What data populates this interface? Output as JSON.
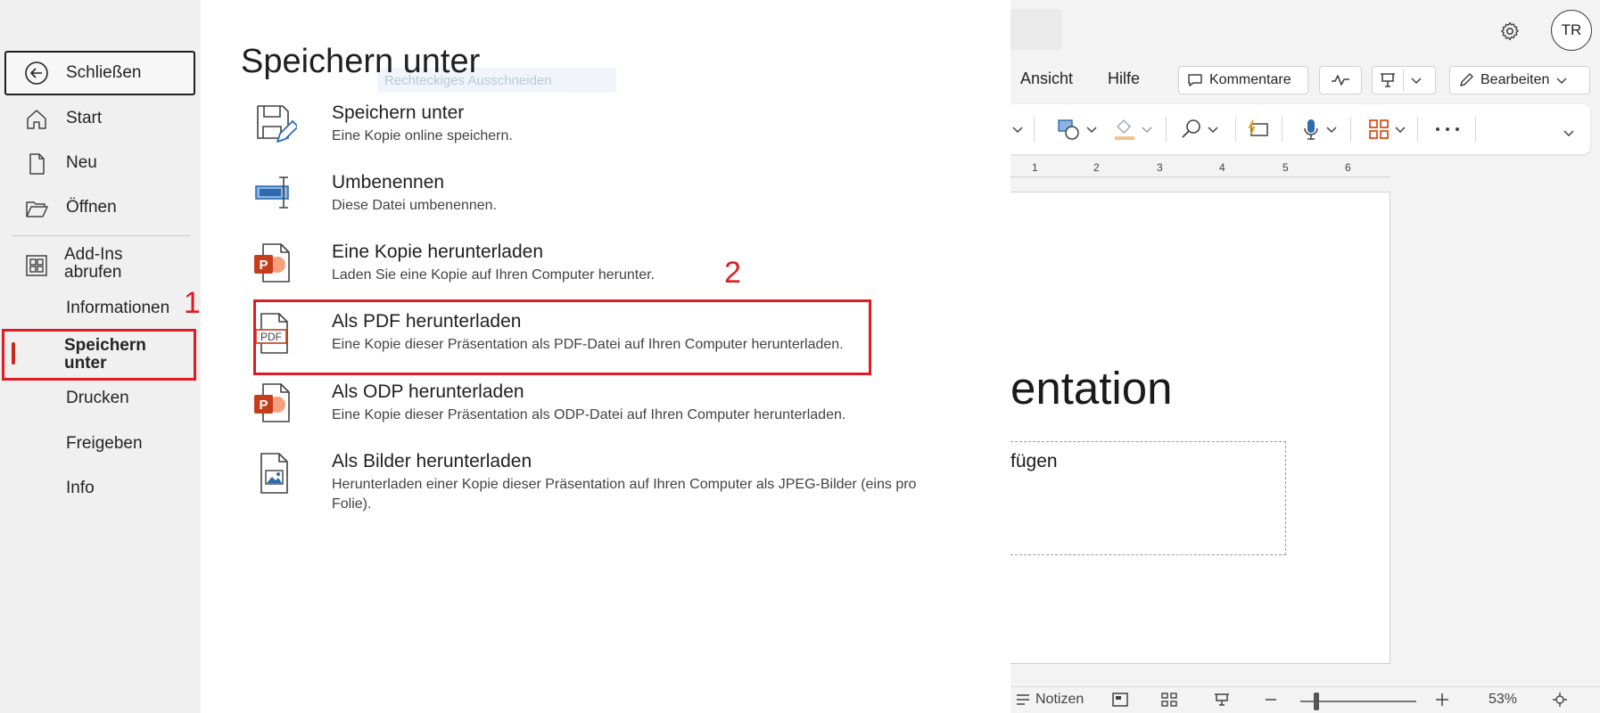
{
  "background": {
    "menu": [
      "Ansicht",
      "Hilfe"
    ],
    "comments_label": "Kommentare",
    "edit_label": "Bearbeiten",
    "avatar": "TR",
    "ruler_marks": [
      "1",
      "2",
      "3",
      "4",
      "5",
      "6"
    ],
    "slide_title": "entation",
    "slide_subtitle": "fügen",
    "status": {
      "notes_label": "Notizen",
      "zoom": "53%"
    }
  },
  "leftnav": {
    "close": "Schließen",
    "start": "Start",
    "new": "Neu",
    "open": "Öffnen",
    "addins_line1": "Add-Ins",
    "addins_line2": "abrufen",
    "informationen": "Informationen",
    "save_as_line1": "Speichern",
    "save_as_line2": "unter",
    "print": "Drucken",
    "share": "Freigeben",
    "info": "Info"
  },
  "annotations": {
    "step1": "1",
    "step2": "2"
  },
  "main": {
    "title": "Speichern unter",
    "ghost_tooltip": "Rechteckiges Ausschneiden",
    "options": [
      {
        "title": "Speichern unter",
        "desc": "Eine Kopie online speichern.",
        "icon": "save-as-icon"
      },
      {
        "title": "Umbenennen",
        "desc": "Diese Datei umbenennen.",
        "icon": "rename-icon"
      },
      {
        "title": "Eine Kopie herunterladen",
        "desc": "Laden Sie eine Kopie auf Ihren Computer herunter.",
        "icon": "powerpoint-file-icon"
      },
      {
        "title": "Als PDF herunterladen",
        "desc": "Eine Kopie dieser Präsentation als PDF-Datei auf Ihren Computer herunterladen.",
        "icon": "pdf-file-icon",
        "icon_text": "PDF"
      },
      {
        "title": "Als ODP herunterladen",
        "desc": "Eine Kopie dieser Präsentation als ODP-Datei auf Ihren Computer herunterladen.",
        "icon": "powerpoint-file-icon"
      },
      {
        "title": "Als Bilder herunterladen",
        "desc": "Herunterladen einer Kopie dieser Präsentation auf Ihren Computer als JPEG-Bilder (eins pro Folie).",
        "icon": "image-file-icon"
      }
    ]
  },
  "colors": {
    "annotation_red": "#e01b24",
    "powerpoint_orange": "#c43e1c",
    "accent_blue": "#2b6cb0"
  }
}
